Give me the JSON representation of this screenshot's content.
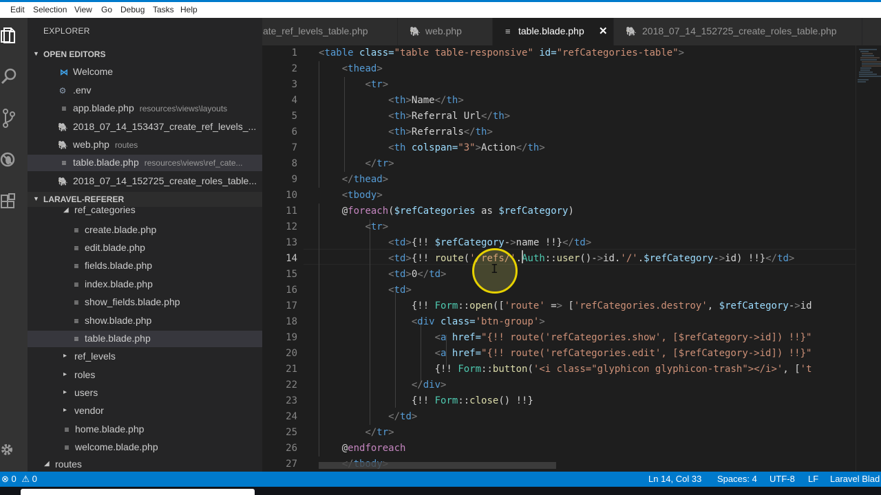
{
  "menu": [
    "Edit",
    "Selection",
    "View",
    "Go",
    "Debug",
    "Tasks",
    "Help"
  ],
  "activity_icons": [
    "explorer-icon",
    "search-icon",
    "source-control-icon",
    "debug-icon",
    "extensions-icon",
    "gear-icon"
  ],
  "sidebar": {
    "title": "EXPLORER",
    "open_editors_title": "OPEN EDITORS",
    "open_editors": [
      {
        "name": "Welcome",
        "desc": "",
        "icon": "vscode-icon"
      },
      {
        "name": ".env",
        "desc": "",
        "icon": "gear-file-icon"
      },
      {
        "name": "app.blade.php",
        "desc": "resources\\views\\layouts",
        "icon": "lines-file-icon"
      },
      {
        "name": "2018_07_14_153437_create_ref_levels_...",
        "desc": "",
        "icon": "php-icon"
      },
      {
        "name": "web.php",
        "desc": "routes",
        "icon": "php-icon"
      },
      {
        "name": "table.blade.php",
        "desc": "resources\\views\\ref_cate...",
        "icon": "lines-file-icon"
      },
      {
        "name": "2018_07_14_152725_create_roles_table...",
        "desc": "",
        "icon": "php-icon"
      }
    ],
    "project_title": "LARAVEL-REFERER",
    "tree": [
      {
        "name": "ref_categories",
        "type": "folder-open",
        "level": 1
      },
      {
        "name": "create.blade.php",
        "type": "file",
        "level": 2
      },
      {
        "name": "edit.blade.php",
        "type": "file",
        "level": 2
      },
      {
        "name": "fields.blade.php",
        "type": "file",
        "level": 2
      },
      {
        "name": "index.blade.php",
        "type": "file",
        "level": 2
      },
      {
        "name": "show_fields.blade.php",
        "type": "file",
        "level": 2
      },
      {
        "name": "show.blade.php",
        "type": "file",
        "level": 2
      },
      {
        "name": "table.blade.php",
        "type": "file",
        "level": 2
      },
      {
        "name": "ref_levels",
        "type": "folder",
        "level": 1
      },
      {
        "name": "roles",
        "type": "folder",
        "level": 1
      },
      {
        "name": "users",
        "type": "folder",
        "level": 1
      },
      {
        "name": "vendor",
        "type": "folder",
        "level": 1
      },
      {
        "name": "home.blade.php",
        "type": "file",
        "level": 1
      },
      {
        "name": "welcome.blade.php",
        "type": "file",
        "level": 1
      },
      {
        "name": "routes",
        "type": "folder-open",
        "level": 0
      }
    ]
  },
  "tabs": [
    {
      "label": "ate_ref_levels_table.php",
      "icon": "",
      "active": false
    },
    {
      "label": "web.php",
      "icon": "php-icon",
      "active": false
    },
    {
      "label": "table.blade.php",
      "icon": "lines-file-icon",
      "active": true,
      "close": "✕"
    },
    {
      "label": "2018_07_14_152725_create_roles_table.php",
      "icon": "php-icon",
      "active": false
    }
  ],
  "editor": {
    "line_numbers": [
      "1",
      "2",
      "3",
      "4",
      "5",
      "6",
      "7",
      "8",
      "9",
      "10",
      "11",
      "12",
      "13",
      "14",
      "15",
      "16",
      "17",
      "18",
      "19",
      "20",
      "21",
      "22",
      "23",
      "24",
      "25",
      "26",
      "27"
    ],
    "lines": [
      "<table class=\"table table-responsive\" id=\"refCategories-table\">",
      "    <thead>",
      "        <tr>",
      "            <th>Name</th>",
      "            <th>Referral Url</th>",
      "            <th>Referrals</th>",
      "            <th colspan=\"3\">Action</th>",
      "        </tr>",
      "    </thead>",
      "    <tbody>",
      "    @foreach($refCategories as $refCategory)",
      "        <tr>",
      "            <td>{!! $refCategory->name !!}</td>",
      "            <td>{!! route('/refs/'.Auth::user()->id.'/'.$refCategory->id) !!}</td>",
      "            <td>0</td>",
      "            <td>",
      "                {!! Form::open(['route' => ['refCategories.destroy', $refCategory->id",
      "                <div class='btn-group'>",
      "                    <a href=\"{!! route('refCategories.show', [$refCategory->id]) !!}\"",
      "                    <a href=\"{!! route('refCategories.edit', [$refCategory->id]) !!}\"",
      "                    {!! Form::button('<i class=\"glyphicon glyphicon-trash\"></i>', ['t",
      "                </div>",
      "                {!! Form::close() !!}",
      "            </td>",
      "        </tr>",
      "    @endforeach",
      "    </tbody>"
    ]
  },
  "status": {
    "errors": "0",
    "warnings": "0",
    "position": "Ln 14, Col 33",
    "spaces": "Spaces: 4",
    "encoding": "UTF-8",
    "eol": "LF",
    "language": "Laravel Blad"
  },
  "colors": {
    "accent": "#007acc",
    "sidebar_bg": "#252526",
    "editor_bg": "#1e1e1e",
    "activity_bg": "#333333"
  }
}
